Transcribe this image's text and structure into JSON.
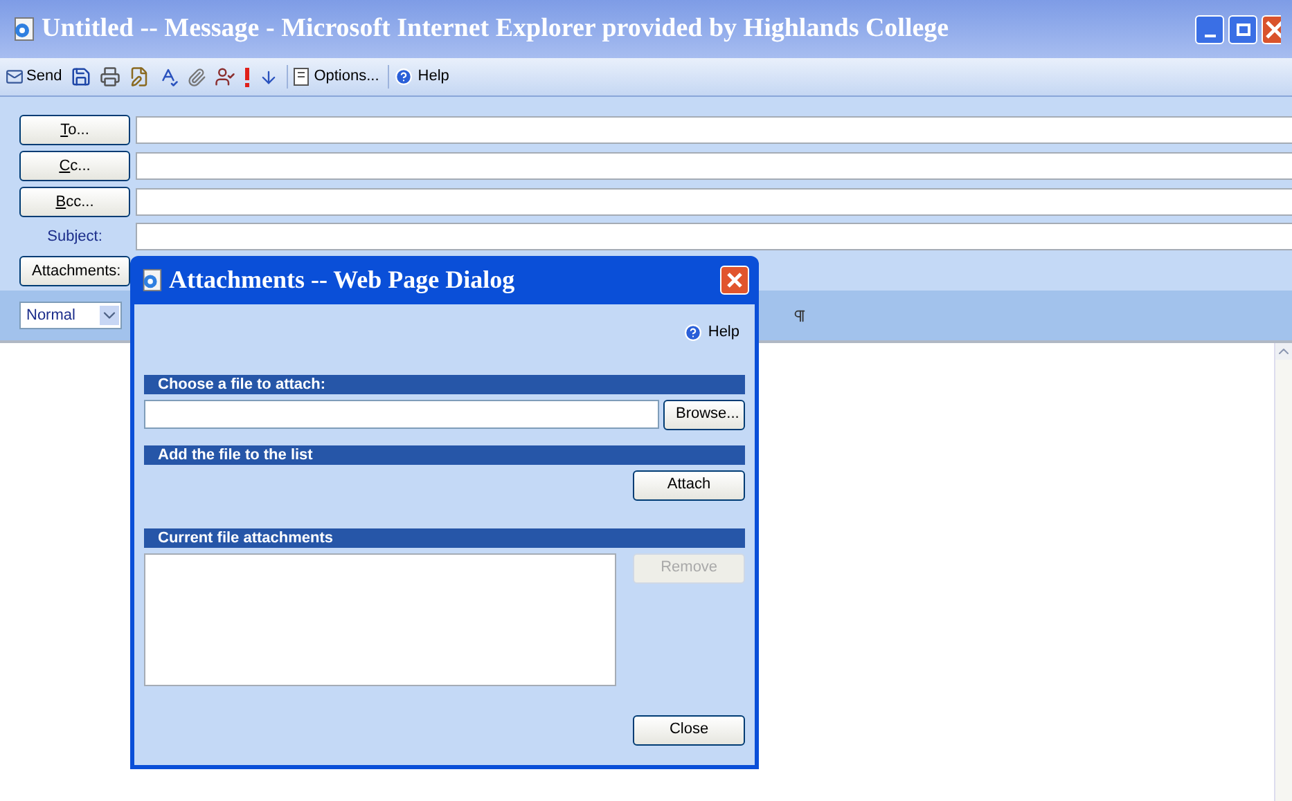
{
  "window": {
    "title": "Untitled -- Message - Microsoft Internet Explorer provided by Highlands College"
  },
  "toolbar": {
    "send": "Send",
    "options": "Options...",
    "help": "Help"
  },
  "header_fields": [
    {
      "kind": "button",
      "label": "To...",
      "underline_first": true
    },
    {
      "kind": "button",
      "label": "Cc...",
      "underline_first": true
    },
    {
      "kind": "button",
      "label": "Bcc...",
      "underline_first": true
    },
    {
      "kind": "label",
      "label": "Subject:"
    }
  ],
  "attachments_button": "Attachments:",
  "format_bar": {
    "style": "Normal"
  },
  "dialog": {
    "title": "Attachments -- Web Page Dialog",
    "help": "Help",
    "choose_heading": "Choose a file to attach:",
    "browse": "Browse...",
    "add_heading": "Add the file to the list",
    "attach": "Attach",
    "current_heading": "Current file attachments",
    "remove": {
      "label": "Remove",
      "disabled": true
    },
    "close": "Close"
  }
}
